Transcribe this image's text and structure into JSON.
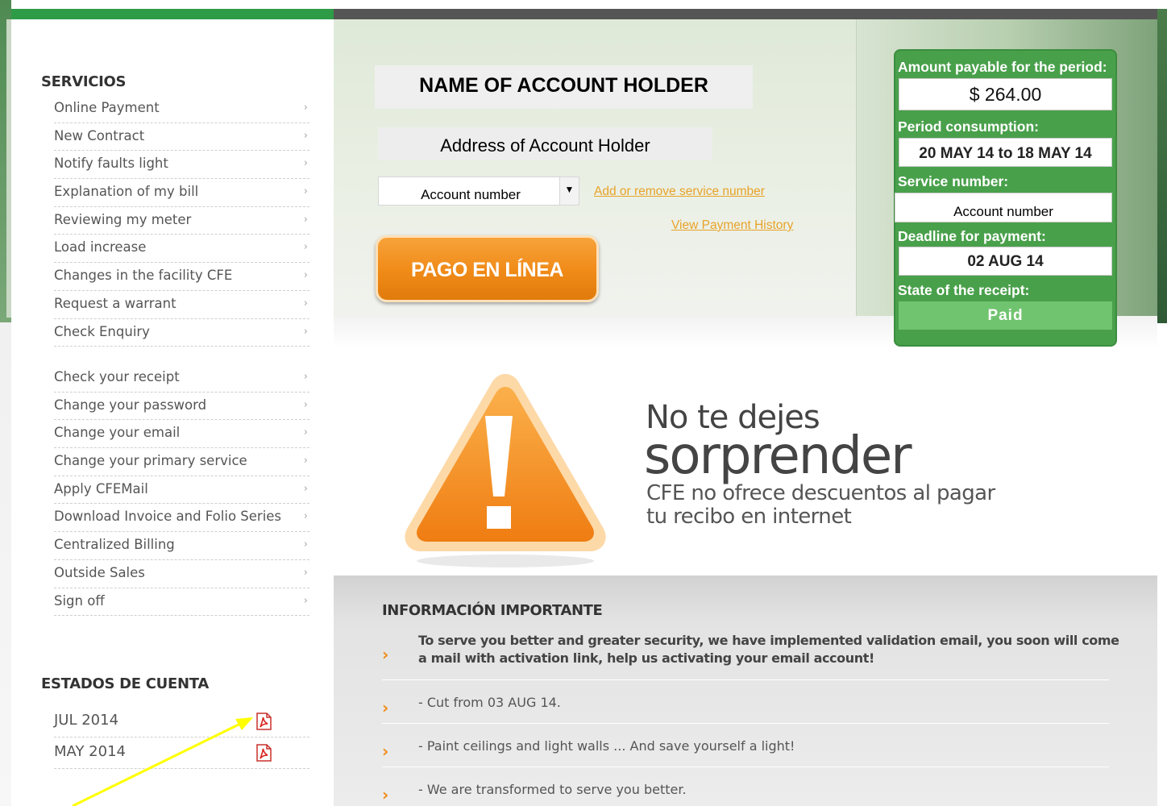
{
  "sidebar": {
    "services_title": "SERVICIOS",
    "chevron": "›",
    "items": [
      {
        "label": "Online Payment"
      },
      {
        "label": "New Contract"
      },
      {
        "label": "Notify faults light"
      },
      {
        "label": "Explanation of my bill"
      },
      {
        "label": "Reviewing my meter"
      },
      {
        "label": "Load increase"
      },
      {
        "label": "Changes in the facility CFE"
      },
      {
        "label": "Request a warrant"
      },
      {
        "label": "Check Enquiry"
      }
    ],
    "items2": [
      {
        "label": "Check your receipt"
      },
      {
        "label": "Change your password"
      },
      {
        "label": "Change your email"
      },
      {
        "label": "Change your primary service"
      },
      {
        "label": "Apply CFEMail"
      },
      {
        "label": "Download Invoice and Folio Series"
      },
      {
        "label": "Centralized Billing"
      },
      {
        "label": "Outside Sales"
      },
      {
        "label": "Sign off"
      }
    ],
    "statements_title": "ESTADOS DE CUENTA",
    "statements": [
      {
        "label": "JUL 2014",
        "icon": "pdf-icon"
      },
      {
        "label": "MAY 2014",
        "icon": "pdf-icon"
      }
    ]
  },
  "account": {
    "holder_name": "NAME OF ACCOUNT HOLDER",
    "address": "Address of Account Holder",
    "account_select_value": "Account number",
    "select_arrow": "▼",
    "add_remove_link": "Add or remove service number",
    "history_link": "View Payment History",
    "pay_button": "PAGO EN LÍNEA"
  },
  "summary": {
    "amount_label": "Amount payable for the period:",
    "amount_value": "$ 264.00",
    "period_label": "Period consumption:",
    "period_value": "20 MAY 14 to 18 MAY 14",
    "service_label": "Service number:",
    "service_value": "Account number",
    "deadline_label": "Deadline for payment:",
    "deadline_value": "02 AUG 14",
    "state_label": "State of the receipt:",
    "state_value": "Paid"
  },
  "banner": {
    "line1": "No te dejes",
    "line2": "sorprender",
    "line3": "CFE no ofrece descuentos al pagar",
    "line4": "tu recibo en internet"
  },
  "info": {
    "title": "INFORMACIÓN IMPORTANTE",
    "chevron": "›",
    "items": [
      {
        "text_line1": "To serve you better and greater security, we have implemented validation email, you soon will come",
        "text_line2": "a mail with activation link, help us activating your email account!"
      },
      {
        "text": "- Cut from 03 AUG 14."
      },
      {
        "text": "- Paint ceilings and light walls ... And save yourself a light!"
      },
      {
        "text": "- We are transformed to serve you better."
      }
    ]
  },
  "colors": {
    "brand_green": "#2e9c47",
    "panel_green": "#49a04b",
    "accent_orange": "#f08a17",
    "link_orange": "#e8a329",
    "annotation_yellow": "#ffff00"
  }
}
